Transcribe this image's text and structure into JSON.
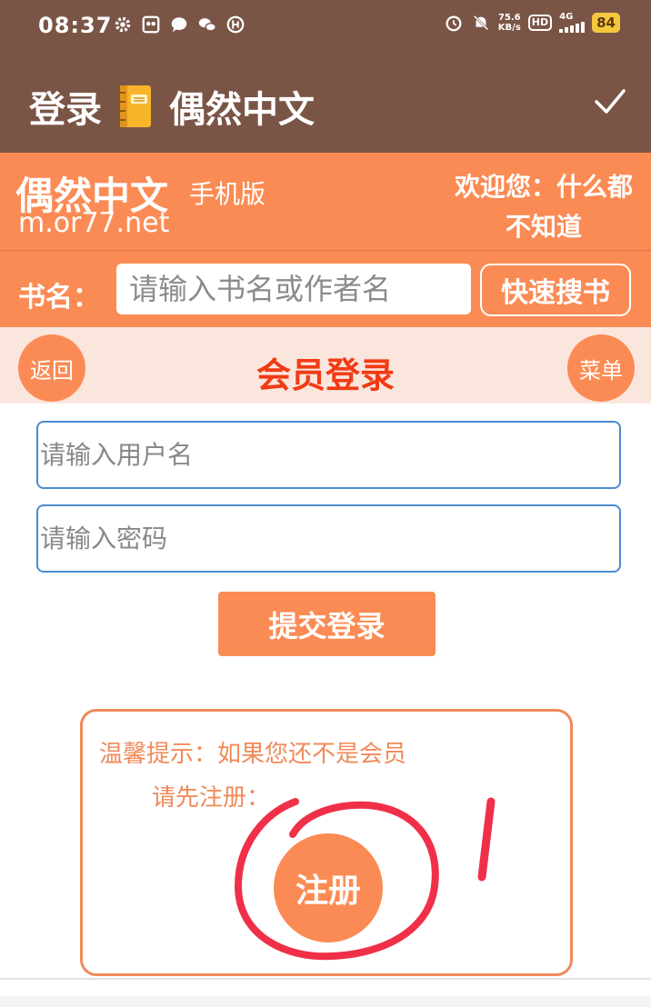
{
  "status_bar": {
    "time": "08:37",
    "net_speed_value": "75.6",
    "net_speed_unit": "KB/s",
    "hd": "HD",
    "signal": "4G",
    "battery": "84",
    "icons": [
      "settings-icon",
      "app-icon",
      "message-icon",
      "wechat-icon",
      "unknown-app-icon",
      "alarm-icon",
      "mute-icon",
      "signal-icon"
    ]
  },
  "app_bar": {
    "title_left": "登录",
    "title_right": "偶然中文",
    "emoji_icon": "notebook-icon",
    "confirm_icon": "check-icon"
  },
  "site_header": {
    "logo": "偶然中文",
    "edition": "手机版",
    "domain": "m.or77.net",
    "welcome": "欢迎您：什么都不知道"
  },
  "search": {
    "label": "书名：",
    "placeholder": "请输入书名或作者名",
    "button": "快速搜书"
  },
  "nav": {
    "back": "返回",
    "title": "会员登录",
    "menu": "菜单"
  },
  "login": {
    "username_placeholder": "请输入用户名",
    "password_placeholder": "请输入密码",
    "submit": "提交登录"
  },
  "tip": {
    "line1": "温馨提示：如果您还不是会员",
    "line2": "请先注册：",
    "register": "注册"
  },
  "colors": {
    "brown": "#7a5546",
    "orange": "#fb8b54",
    "nav_bg": "#fbe6de",
    "title_red": "#f23b14",
    "input_border": "#4a8ccf",
    "annotation_red": "#f03048"
  }
}
